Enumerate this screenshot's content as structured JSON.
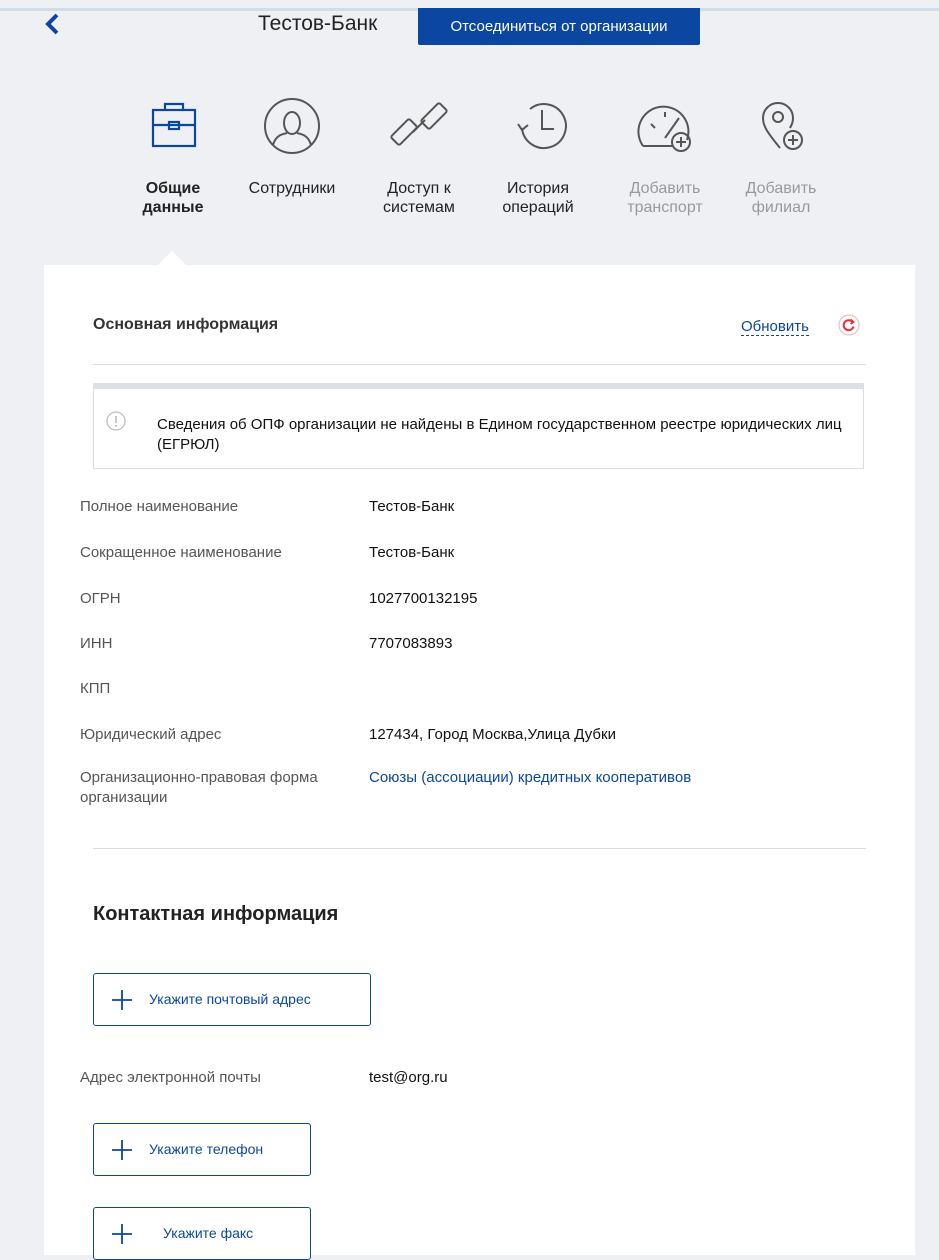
{
  "header": {
    "org_name": "Тестов-Банк",
    "leave_button": "Отсоединиться от организации"
  },
  "tabs": [
    {
      "label": "Общие данные",
      "icon": "briefcase-icon",
      "state": "active"
    },
    {
      "label": "Сотрудники",
      "icon": "person-icon",
      "state": "normal"
    },
    {
      "label": "Доступ к системам",
      "icon": "chain-link-icon",
      "state": "normal"
    },
    {
      "label": "История операций",
      "icon": "history-clock-icon",
      "state": "normal"
    },
    {
      "label": "Добавить транспорт",
      "icon": "speedometer-plus-icon",
      "state": "disabled"
    },
    {
      "label": "Добавить филиал",
      "icon": "location-plus-icon",
      "state": "disabled"
    }
  ],
  "main_info": {
    "title": "Основная информация",
    "refresh_label": "Обновить",
    "alert_text": "Сведения об ОПФ организации не найдены в Едином государственном реестре юридических лиц (ЕГРЮЛ)",
    "rows": [
      {
        "label": "Полное наименование",
        "value": "Тестов-Банк"
      },
      {
        "label": "Сокращенное наименование",
        "value": "Тестов-Банк"
      },
      {
        "label": "ОГРН",
        "value": "1027700132195"
      },
      {
        "label": "ИНН",
        "value": "7707083893"
      },
      {
        "label": "КПП",
        "value": ""
      },
      {
        "label": "Юридический адрес",
        "value": "127434, Город Москва,Улица Дубки"
      },
      {
        "label": "Организационно-правовая форма организации",
        "value": "Союзы (ассоциации) кредитных кооперативов"
      }
    ]
  },
  "contact_info": {
    "title": "Контактная информация",
    "add_postal_address": "Укажите почтовый адрес",
    "email_label": "Адрес электронной почты",
    "email_value": "test@org.ru",
    "add_phone": "Укажите телефон",
    "add_fax": "Укажите факс"
  },
  "colors": {
    "accent": "#0b47a1",
    "refresh_icon": "#e3323a",
    "disabled_text": "#999999"
  }
}
